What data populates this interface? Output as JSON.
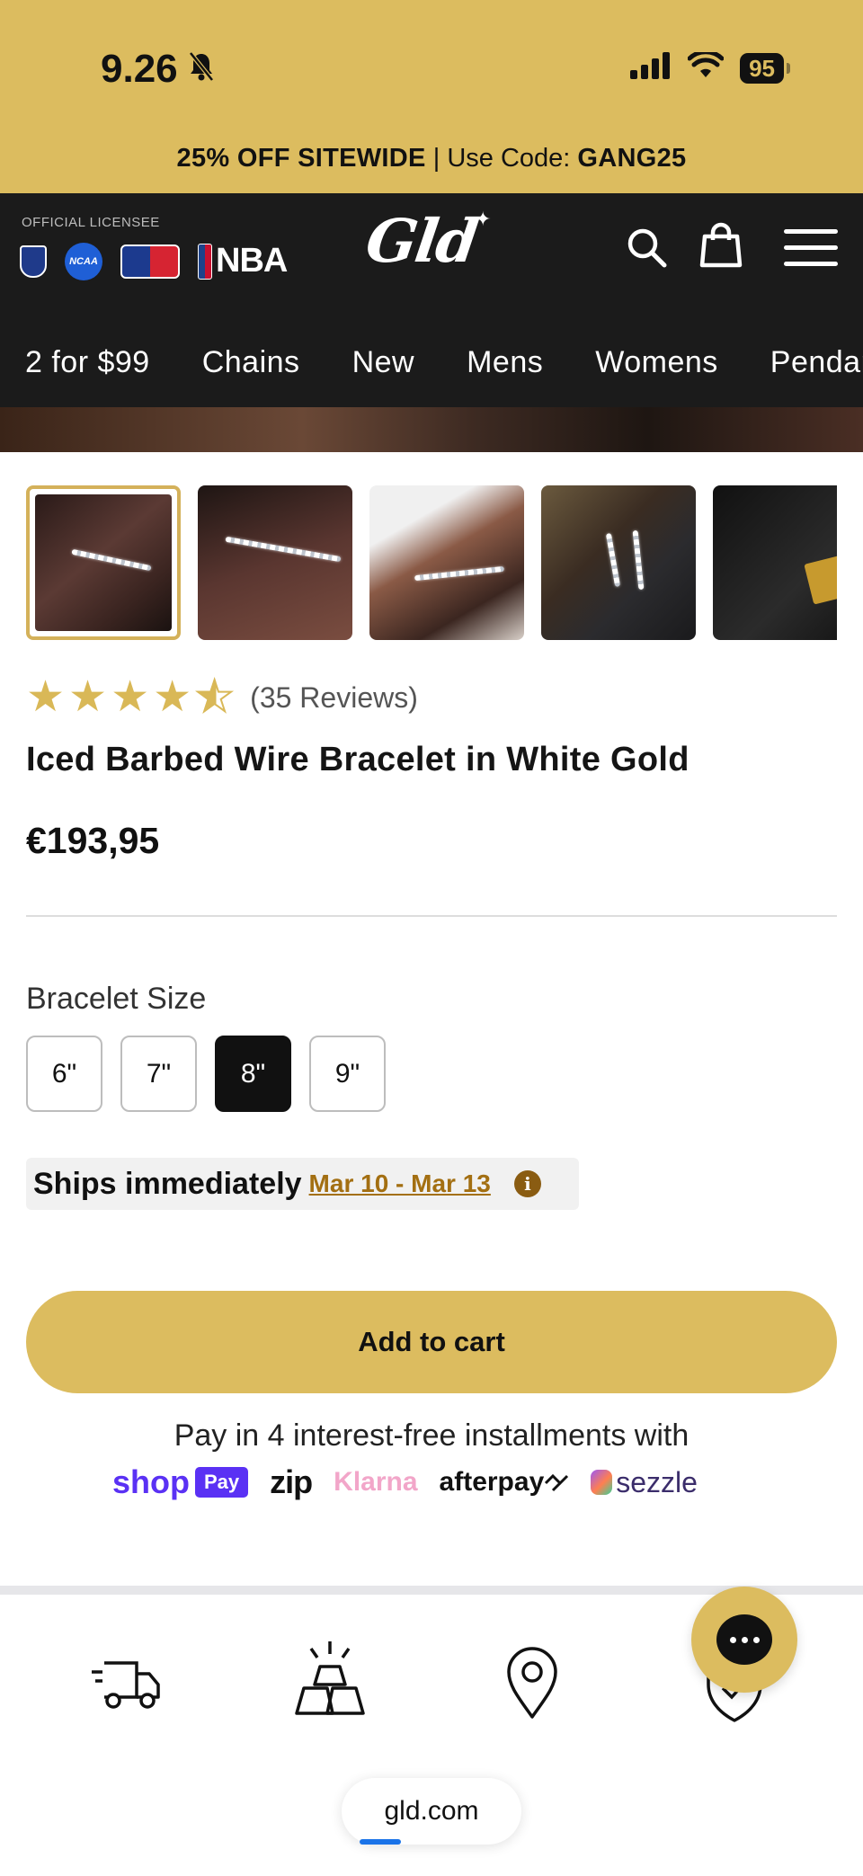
{
  "status_bar": {
    "time": "9.26",
    "battery": "95"
  },
  "promo": {
    "bold_text": "25% OFF SITEWIDE",
    "separator": " | Use Code: ",
    "code": "GANG25"
  },
  "header": {
    "licensee_label": "OFFICIAL LICENSEE",
    "ncaa_text": "NCAA",
    "nba_text": "NBA",
    "brand": "Gld",
    "nav": [
      "2 for $99",
      "Chains",
      "New",
      "Mens",
      "Womens",
      "Pendants"
    ]
  },
  "product": {
    "review_count": "(35 Reviews)",
    "rating": 4.5,
    "title": "Iced Barbed Wire Bracelet in White Gold",
    "price": "€193,95",
    "size_label": "Bracelet Size",
    "sizes": [
      "6\"",
      "7\"",
      "8\"",
      "9\""
    ],
    "selected_size": "8\"",
    "ship_main": "Ships immediately",
    "ship_dates": "Mar 10 - Mar 13",
    "info_glyph": "i",
    "add_to_cart": "Add to cart"
  },
  "payment": {
    "text": "Pay in 4 interest-free installments with",
    "shop": "shop",
    "shop_pay": "Pay",
    "zip": "zip",
    "klarna": "Klarna",
    "afterpay": "afterpay",
    "sezzle": "sezzle"
  },
  "browser": {
    "url": "gld.com",
    "progress": 0.23
  },
  "colors": {
    "gold": "#dcbc5f",
    "dark": "#1b1b1b",
    "date_link": "#a36f12",
    "shop_pay": "#5a31f4"
  }
}
